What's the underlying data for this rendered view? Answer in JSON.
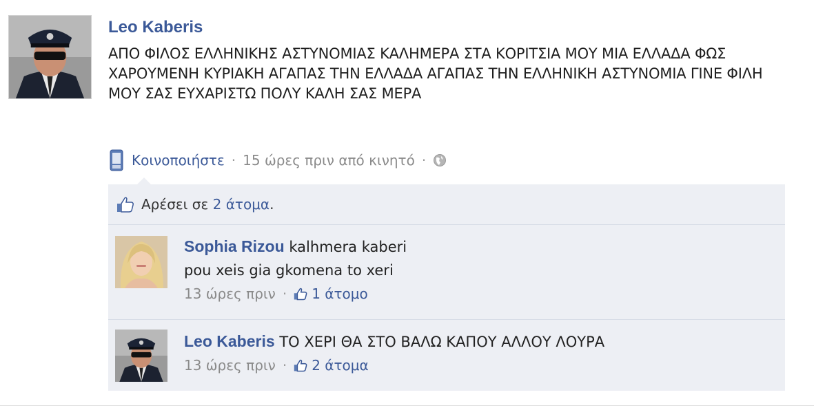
{
  "post": {
    "author": "Leo Kaberis",
    "text": "ΑΠΟ ΦΙΛΟΣ ΕΛΛΗΝΙΚΗΣ ΑΣΤΥΝΟΜΙΑΣ ΚΑΛΗΜΕΡΑ ΣΤΑ ΚΟΡΙΤΣΙΑ ΜΟΥ ΜΙΑ ΕΛΛΑΔΑ ΦΩΣ ΧΑΡΟΥΜΕΝΗ ΚΥΡΙΑΚΗ ΑΓΑΠΑΣ ΤΗΝ ΕΛΛΑΔΑ ΑΓΑΠΑΣ ΤΗΝ ΕΛΛΗΝΙΚΗ ΑΣΤΥΝΟΜΙΑ ΓΙΝΕ ΦΙΛΗ ΜΟΥ ΣΑΣ ΕΥΧΑΡΙΣΤΩ ΠΟΛΥ ΚΑΛΗ ΣΑΣ ΜΕΡΑ",
    "share_label": "Κοινοποιήστε",
    "time": "15 ώρες πριν από κινητό",
    "separator": "·"
  },
  "likes": {
    "prefix": "Αρέσει σε",
    "link": "2 άτομα",
    "suffix": "."
  },
  "comments": [
    {
      "author": "Sophia Rizou",
      "line1": "kalhmera kaberi",
      "line2": "pou xeis gia gkomena to xeri",
      "time": "13 ώρες πριν",
      "likes": "1 άτομο"
    },
    {
      "author": "Leo Kaberis",
      "line1": "ΤΟ ΧΕΡΙ ΘΑ ΣΤΟ ΒΑΛΩ ΚΑΠΟΥ ΑΛΛΟΥ ΛΟΥΡΑ",
      "time": "13 ώρες πριν",
      "likes": "2 άτομα"
    }
  ],
  "colors": {
    "link": "#3b5998",
    "panel": "#edeff4",
    "meta": "#8a8a8a"
  },
  "icons": [
    "mobile-icon",
    "globe-icon",
    "thumbs-up-icon"
  ]
}
